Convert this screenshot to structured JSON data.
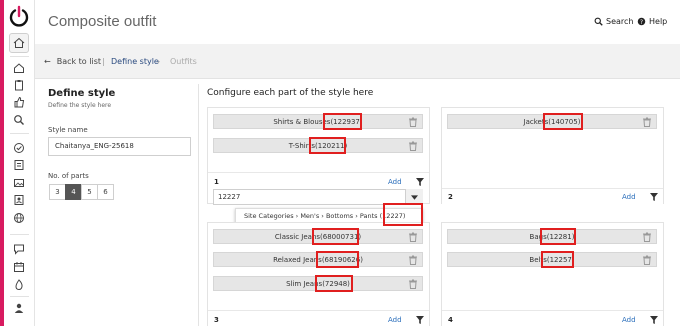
{
  "app": {
    "accent_color": "#d81b60",
    "title_color": "#666666",
    "highlight_color": "#e01f1f"
  },
  "header": {
    "title": "Composite outfit",
    "search_label": "Search",
    "help_label": "Help"
  },
  "breadcrumb": {
    "back_label": "Back to list",
    "separator": "|",
    "active": "Define style",
    "chevron": "›",
    "inactive": "Outfits"
  },
  "define_style": {
    "heading": "Define style",
    "subtitle": "Define the style here",
    "style_name_label": "Style name",
    "style_name_value": "Chaitanya_ENG-25618",
    "parts_label": "No. of parts",
    "parts_options": [
      "3",
      "4",
      "5",
      "6"
    ],
    "parts_selected": "4"
  },
  "configure": {
    "heading": "Configure each part of the style here",
    "add_label": "Add",
    "parts": [
      {
        "number": "1",
        "items": [
          "Shirts & Blouses",
          "(122937)",
          "T-Shirts",
          "(120211)"
        ],
        "search_value": "12227",
        "suggestion": "Site Categories › Men's › Bottoms › Pants (12227)"
      },
      {
        "number": "2",
        "items": [
          "Jackets",
          "(140705)"
        ]
      },
      {
        "number": "3",
        "items": [
          "Classic Jeans",
          "(68000731)",
          "Relaxed Jeans",
          "(68190626)",
          "Slim Jeans",
          "(72948)"
        ]
      },
      {
        "number": "4",
        "items": [
          "Bags",
          "(12281)",
          "Belts",
          "(12257)"
        ]
      }
    ]
  },
  "sidebar_icons": [
    "power-logo",
    "home-icon",
    "house-icon",
    "clipboard-icon",
    "thumbs-up-icon",
    "search-icon",
    "check-circle-icon",
    "list-icon",
    "image-icon",
    "contact-icon",
    "globe-icon",
    "chat-icon",
    "calendar-icon",
    "fire-icon",
    "user-icon"
  ]
}
